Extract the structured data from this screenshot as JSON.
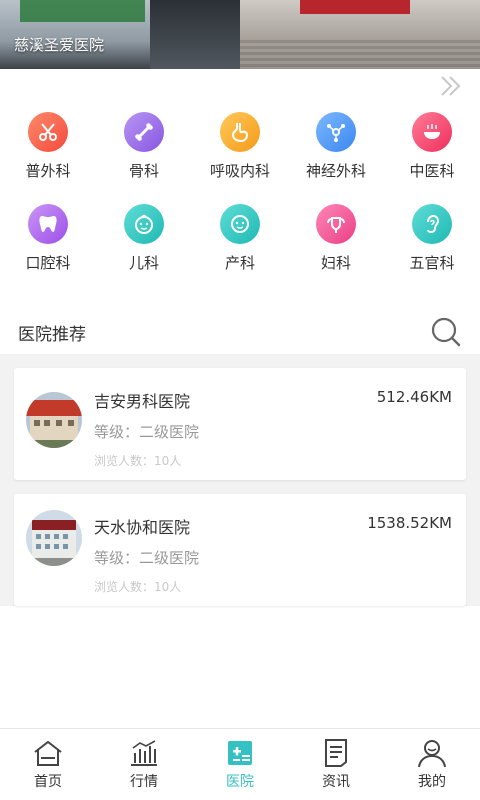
{
  "banner": {
    "caption": "慈溪圣爱医院"
  },
  "departments": [
    {
      "label": "普外科",
      "icon": "scissors-icon",
      "color": "#f5604e"
    },
    {
      "label": "骨科",
      "icon": "bone-icon",
      "color": "#9b74e8"
    },
    {
      "label": "呼吸内科",
      "icon": "stomach-icon",
      "color": "#f9b02e"
    },
    {
      "label": "神经外科",
      "icon": "neuron-icon",
      "color": "#4f9df5"
    },
    {
      "label": "中医科",
      "icon": "herbal-bowl-icon",
      "color": "#f5456c"
    },
    {
      "label": "口腔科",
      "icon": "tooth-icon",
      "color": "#b26df0"
    },
    {
      "label": "儿科",
      "icon": "child-face-icon",
      "color": "#2ec9c4"
    },
    {
      "label": "产科",
      "icon": "baby-face-icon",
      "color": "#2ec9c4"
    },
    {
      "label": "妇科",
      "icon": "uterus-icon",
      "color": "#f35b9c"
    },
    {
      "label": "五官科",
      "icon": "ear-icon",
      "color": "#2ec9c4"
    }
  ],
  "recommend": {
    "title": "医院推荐"
  },
  "hospitals": [
    {
      "name": "吉安男科医院",
      "distance": "512.46KM",
      "level": "等级：二级医院",
      "views": "浏览人数：10人"
    },
    {
      "name": "天水协和医院",
      "distance": "1538.52KM",
      "level": "等级：二级医院",
      "views": "浏览人数：10人"
    }
  ],
  "tabs": [
    {
      "label": "首页",
      "icon": "home-icon",
      "active": false
    },
    {
      "label": "行情",
      "icon": "chart-icon",
      "active": false
    },
    {
      "label": "医院",
      "icon": "hospital-icon",
      "active": true
    },
    {
      "label": "资讯",
      "icon": "news-icon",
      "active": false
    },
    {
      "label": "我的",
      "icon": "user-icon",
      "active": false
    }
  ],
  "colors": {
    "accent": "#35c0c4",
    "list_bg": "#f2f2f2"
  }
}
